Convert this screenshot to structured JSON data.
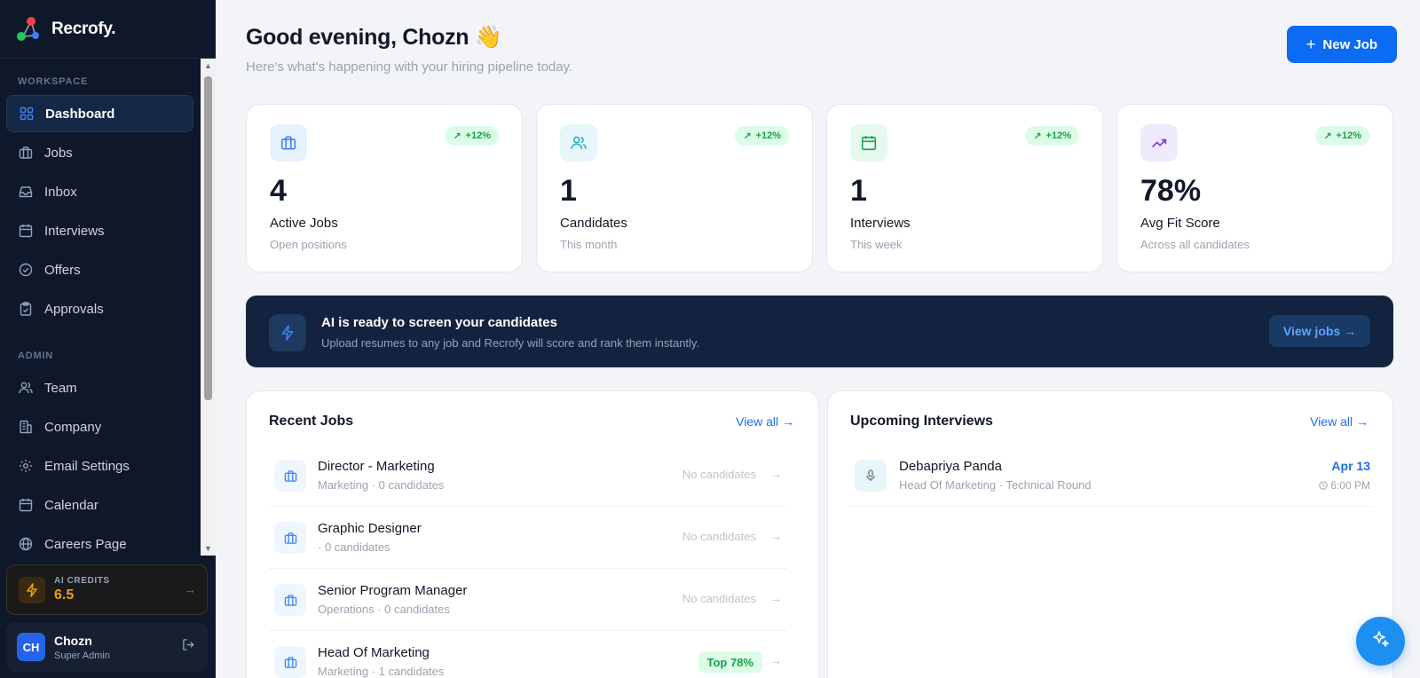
{
  "brand": {
    "name": "Recrofy."
  },
  "sidebar": {
    "workspace_label": "WORKSPACE",
    "admin_label": "ADMIN",
    "workspace_items": [
      {
        "label": "Dashboard",
        "icon": "dashboard-icon",
        "active": true
      },
      {
        "label": "Jobs",
        "icon": "briefcase-icon"
      },
      {
        "label": "Inbox",
        "icon": "inbox-icon"
      },
      {
        "label": "Interviews",
        "icon": "calendar-icon"
      },
      {
        "label": "Offers",
        "icon": "check-circle-icon"
      },
      {
        "label": "Approvals",
        "icon": "clipboard-icon"
      }
    ],
    "admin_items": [
      {
        "label": "Team",
        "icon": "users-icon"
      },
      {
        "label": "Company",
        "icon": "building-icon"
      },
      {
        "label": "Email Settings",
        "icon": "gear-icon"
      },
      {
        "label": "Calendar",
        "icon": "calendar-icon"
      },
      {
        "label": "Careers Page",
        "icon": "globe-icon"
      }
    ],
    "credits": {
      "label": "AI CREDITS",
      "value": "6.5",
      "accent": "#f59e0b"
    },
    "user": {
      "initials": "CH",
      "name": "Chozn",
      "role": "Super Admin"
    }
  },
  "header": {
    "greeting": "Good evening, Chozn 👋",
    "subtitle": "Here's what's happening with your hiring pipeline today.",
    "new_job_label": "New Job",
    "accent": "#0b6bf2"
  },
  "stats": [
    {
      "value": "4",
      "label": "Active Jobs",
      "sub": "Open positions",
      "trend": "+12%",
      "icon": "briefcase-icon",
      "icon_bg": "#e8f1fe",
      "icon_color": "#3b82f6"
    },
    {
      "value": "1",
      "label": "Candidates",
      "sub": "This month",
      "trend": "+12%",
      "icon": "users-icon",
      "icon_bg": "#e6f6f9",
      "icon_color": "#14b8c6"
    },
    {
      "value": "1",
      "label": "Interviews",
      "sub": "This week",
      "trend": "+12%",
      "icon": "calendar-icon",
      "icon_bg": "#e6f8ef",
      "icon_color": "#16a34a"
    },
    {
      "value": "78%",
      "label": "Avg Fit Score",
      "sub": "Across all candidates",
      "trend": "+12%",
      "icon": "trending-up-icon",
      "icon_bg": "#efeafe",
      "icon_color": "#7c3aed"
    }
  ],
  "banner": {
    "title": "AI is ready to screen your candidates",
    "subtitle": "Upload resumes to any job and Recrofy will score and rank them instantly.",
    "button_label": "View jobs →"
  },
  "recent_jobs": {
    "title": "Recent Jobs",
    "view_all": "View all →",
    "items": [
      {
        "title": "Director - Marketing",
        "sub": "Marketing · 0 candidates",
        "status": "No candidates"
      },
      {
        "title": "Graphic Designer",
        "sub": "· 0 candidates",
        "status": "No candidates"
      },
      {
        "title": "Senior Program Manager",
        "sub": "Operations · 0 candidates",
        "status": "No candidates"
      },
      {
        "title": "Head Of Marketing",
        "sub": "Marketing · 1 candidates",
        "badge": "Top 78%"
      }
    ]
  },
  "upcoming_interviews": {
    "title": "Upcoming Interviews",
    "view_all": "View all →",
    "items": [
      {
        "name": "Debapriya Panda",
        "sub": "Head Of Marketing · Technical Round",
        "date": "Apr 13",
        "time": "6:00 PM"
      }
    ]
  }
}
